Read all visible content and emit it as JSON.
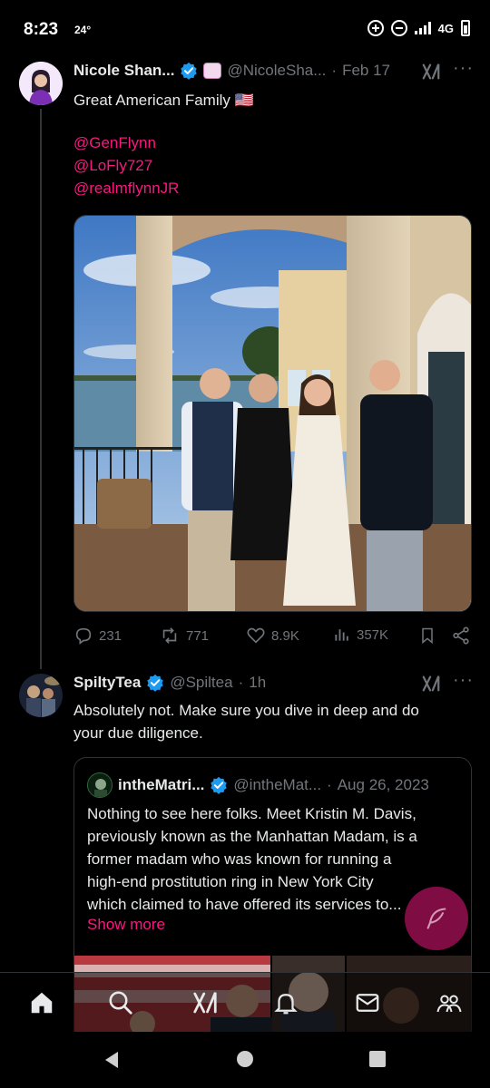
{
  "status_bar": {
    "time": "8:23",
    "temperature": "24°",
    "network": "4G"
  },
  "tweet": {
    "author_name": "Nicole Shan...",
    "handle": "@NicoleSha...",
    "separator": "·",
    "date": "Feb 17",
    "text": "Great American Family 🇺🇸",
    "mentions": [
      "@GenFlynn",
      "@LoFly727",
      "@realmflynnJR"
    ],
    "stats": {
      "replies": "231",
      "reposts": "771",
      "likes": "8.9K",
      "views": "357K"
    }
  },
  "reply": {
    "author_name": "SpiltyTea",
    "handle": "@Spiltea",
    "separator": "·",
    "time": "1h",
    "text_line1": "Absolutely not. Make sure you dive in deep and do",
    "text_line2": "your due diligence.",
    "quote": {
      "author_name": "intheMatri...",
      "handle": "@intheMat...",
      "separator": "·",
      "date": "Aug 26, 2023",
      "lines": [
        "Nothing to see here folks. Meet Kristin M. Davis,",
        "previously known as the Manhattan Madam, is a",
        "former madam who was known for running a",
        "high-end prostitution ring in New York City",
        "which claimed to have offered its services to..."
      ],
      "show_more": "Show more"
    }
  },
  "colors": {
    "accent_pink": "#f91880",
    "verified_blue": "#1d9bf0",
    "muted": "#71767b",
    "fab": "#8a0f4a"
  },
  "icons": {
    "bottom_nav": [
      "home-icon",
      "search-icon",
      "grok-icon",
      "notifications-icon",
      "messages-icon",
      "communities-icon"
    ],
    "android_nav": [
      "back-icon",
      "home-circle-icon",
      "recents-icon"
    ]
  }
}
